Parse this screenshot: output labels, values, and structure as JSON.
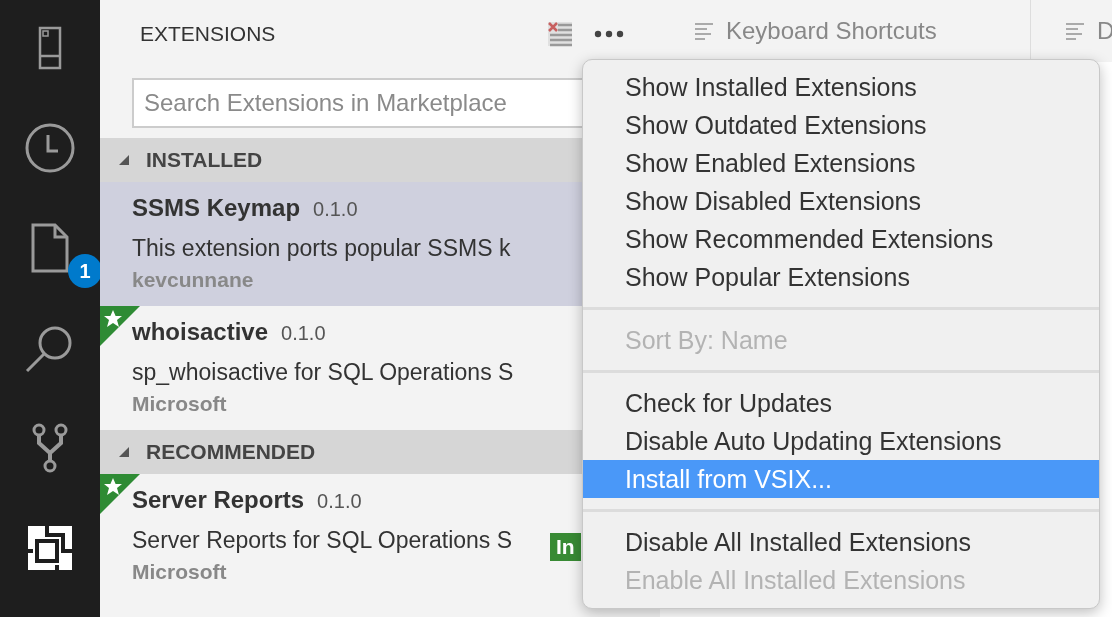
{
  "activity_bar": {
    "items": [
      {
        "kind": "explorer",
        "selected": false
      },
      {
        "kind": "history",
        "selected": false
      },
      {
        "kind": "file",
        "selected": false,
        "badge": "1"
      },
      {
        "kind": "search",
        "selected": false
      },
      {
        "kind": "source-control",
        "selected": false
      },
      {
        "kind": "extensions",
        "selected": true
      }
    ]
  },
  "sidebar": {
    "title": "EXTENSIONS",
    "search": {
      "placeholder": "Search Extensions in Marketplace"
    },
    "sections": [
      {
        "title": "INSTALLED",
        "expanded": true,
        "extensions": [
          {
            "name": "SSMS Keymap",
            "version": "0.1.0",
            "description": "This extension ports popular SSMS k",
            "publisher": "kevcunnane",
            "selected": true,
            "starred": false
          },
          {
            "name": "whoisactive",
            "version": "0.1.0",
            "description": "sp_whoisactive for SQL Operations S",
            "publisher": "Microsoft",
            "selected": false,
            "starred": true
          }
        ]
      },
      {
        "title": "RECOMMENDED",
        "expanded": true,
        "extensions": [
          {
            "name": "Server Reports",
            "version": "0.1.0",
            "description": "Server Reports for SQL Operations S",
            "publisher": "Microsoft",
            "selected": false,
            "starred": true,
            "action": "In"
          }
        ]
      }
    ]
  },
  "editor_tabs": [
    {
      "label": "Keyboard Shortcuts",
      "selected": false
    },
    {
      "label": "D",
      "selected": false
    }
  ],
  "menu": {
    "groups": [
      [
        {
          "label": "Show Installed Extensions",
          "disabled": false,
          "selected": false
        },
        {
          "label": "Show Outdated Extensions",
          "disabled": false,
          "selected": false
        },
        {
          "label": "Show Enabled Extensions",
          "disabled": false,
          "selected": false
        },
        {
          "label": "Show Disabled Extensions",
          "disabled": false,
          "selected": false
        },
        {
          "label": "Show Recommended Extensions",
          "disabled": false,
          "selected": false
        },
        {
          "label": "Show Popular Extensions",
          "disabled": false,
          "selected": false
        }
      ],
      [
        {
          "label": "Sort By: Name",
          "disabled": true,
          "selected": false
        }
      ],
      [
        {
          "label": "Check for Updates",
          "disabled": false,
          "selected": false
        },
        {
          "label": "Disable Auto Updating Extensions",
          "disabled": false,
          "selected": false
        },
        {
          "label": "Install from VSIX...",
          "disabled": false,
          "selected": true
        }
      ],
      [
        {
          "label": "Disable All Installed Extensions",
          "disabled": false,
          "selected": false
        },
        {
          "label": "Enable All Installed Extensions",
          "disabled": true,
          "selected": false
        }
      ]
    ]
  }
}
